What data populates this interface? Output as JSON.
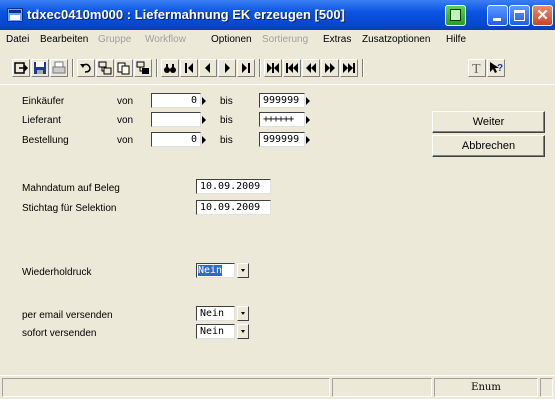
{
  "window": {
    "title": "tdxec0410m000 : Liefermahnung EK erzeugen [500]",
    "icon": "app-icon"
  },
  "menu": [
    {
      "label": "Datei",
      "enabled": true
    },
    {
      "label": "Bearbeiten",
      "enabled": true
    },
    {
      "label": "Gruppe",
      "enabled": false
    },
    {
      "label": "Workflow",
      "enabled": false
    },
    {
      "label": "Optionen",
      "enabled": true
    },
    {
      "label": "Sortierung",
      "enabled": false
    },
    {
      "label": "Extras",
      "enabled": true
    },
    {
      "label": "Zusatzoptionen",
      "enabled": true
    },
    {
      "label": "Hilfe",
      "enabled": true
    }
  ],
  "toolbar": {
    "icons": [
      "exit-icon",
      "save-icon",
      "print-icon",
      "undo-icon",
      "copy-record-icon",
      "paste-record-icon",
      "duplicate-record-icon",
      "find-icon",
      "first-icon",
      "previous-icon",
      "next-icon",
      "last-icon",
      "first-set-icon",
      "first-page-icon",
      "previous-page-icon",
      "next-page-icon",
      "last-page-icon",
      "text-icon",
      "help-icon"
    ]
  },
  "ranges": {
    "von": "von",
    "bis": "bis",
    "rows": [
      {
        "label": "Einkäufer",
        "from": "0",
        "to": "999999"
      },
      {
        "label": "Lieferant",
        "from": "",
        "to": "++++++"
      },
      {
        "label": "Bestellung",
        "from": "0",
        "to": "999999"
      }
    ]
  },
  "buttons": {
    "weiter": "Weiter",
    "abbrechen": "Abbrechen"
  },
  "dates": {
    "mahndatum_label": "Mahndatum auf Beleg",
    "mahndatum_value": "10.09.2009",
    "stichtag_label": "Stichtag für Selektion",
    "stichtag_value": "10.09.2009"
  },
  "options": {
    "wiederholdruck_label": "Wiederholdruck",
    "wiederholdruck_value": "Nein",
    "email_label": "per email versenden",
    "email_value": "Nein",
    "sofort_label": "sofort versenden",
    "sofort_value": "Nein"
  },
  "status": {
    "panel4": "Enum"
  }
}
